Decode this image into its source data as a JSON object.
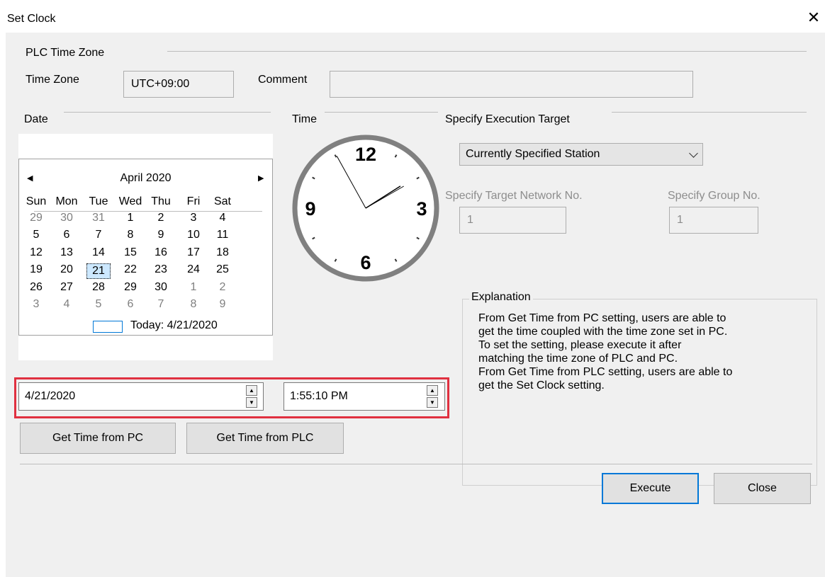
{
  "window": {
    "title": "Set Clock"
  },
  "timezone": {
    "section_title": "PLC Time Zone",
    "label": "Time Zone",
    "value": "UTC+09:00",
    "comment_label": "Comment",
    "comment_value": ""
  },
  "date_section": {
    "title": "Date"
  },
  "time_section": {
    "title": "Time"
  },
  "calendar": {
    "month_title": "April 2020",
    "weekdays": [
      "Sun",
      "Mon",
      "Tue",
      "Wed",
      "Thu",
      "Fri",
      "Sat"
    ],
    "weeks": [
      [
        {
          "d": "29",
          "o": true
        },
        {
          "d": "30",
          "o": true
        },
        {
          "d": "31",
          "o": true
        },
        {
          "d": "1"
        },
        {
          "d": "2"
        },
        {
          "d": "3"
        },
        {
          "d": "4"
        }
      ],
      [
        {
          "d": "5"
        },
        {
          "d": "6"
        },
        {
          "d": "7"
        },
        {
          "d": "8"
        },
        {
          "d": "9"
        },
        {
          "d": "10"
        },
        {
          "d": "11"
        }
      ],
      [
        {
          "d": "12"
        },
        {
          "d": "13"
        },
        {
          "d": "14"
        },
        {
          "d": "15"
        },
        {
          "d": "16"
        },
        {
          "d": "17"
        },
        {
          "d": "18"
        }
      ],
      [
        {
          "d": "19"
        },
        {
          "d": "20"
        },
        {
          "d": "21",
          "sel": true
        },
        {
          "d": "22"
        },
        {
          "d": "23"
        },
        {
          "d": "24"
        },
        {
          "d": "25"
        }
      ],
      [
        {
          "d": "26"
        },
        {
          "d": "27"
        },
        {
          "d": "28"
        },
        {
          "d": "29"
        },
        {
          "d": "30"
        },
        {
          "d": "1",
          "o": true
        },
        {
          "d": "2",
          "o": true
        }
      ],
      [
        {
          "d": "3",
          "o": true
        },
        {
          "d": "4",
          "o": true
        },
        {
          "d": "5",
          "o": true
        },
        {
          "d": "6",
          "o": true
        },
        {
          "d": "7",
          "o": true
        },
        {
          "d": "8",
          "o": true
        },
        {
          "d": "9",
          "o": true
        }
      ]
    ],
    "today_label": "Today: 4/21/2020"
  },
  "clock": {
    "numerals": {
      "twelve": "12",
      "three": "3",
      "six": "6",
      "nine": "9"
    },
    "time": {
      "hour": 1,
      "minute": 55,
      "second": 10
    }
  },
  "date_input": {
    "value": "4/21/2020"
  },
  "time_input": {
    "value": "1:55:10 PM"
  },
  "buttons": {
    "get_pc": "Get Time from PC",
    "get_plc": "Get Time from PLC",
    "execute": "Execute",
    "close": "Close"
  },
  "target": {
    "section_title": "Specify Execution Target",
    "selected": "Currently Specified Station",
    "network_label": "Specify Target Network No.",
    "network_value": "1",
    "group_label": "Specify Group No.",
    "group_value": "1"
  },
  "explanation": {
    "title": "Explanation",
    "lines": [
      "From Get Time from PC setting, users are able to",
      "get the time coupled with the time zone set in PC.",
      "To set the setting, please execute it after",
      "matching the time zone of PLC and PC.",
      "From Get Time from PLC setting, users are able to",
      "get the Set Clock setting."
    ]
  },
  "colors": {
    "highlight": "#e03040",
    "accent": "#0078d7",
    "dialog_bg": "#f0f0f0"
  }
}
